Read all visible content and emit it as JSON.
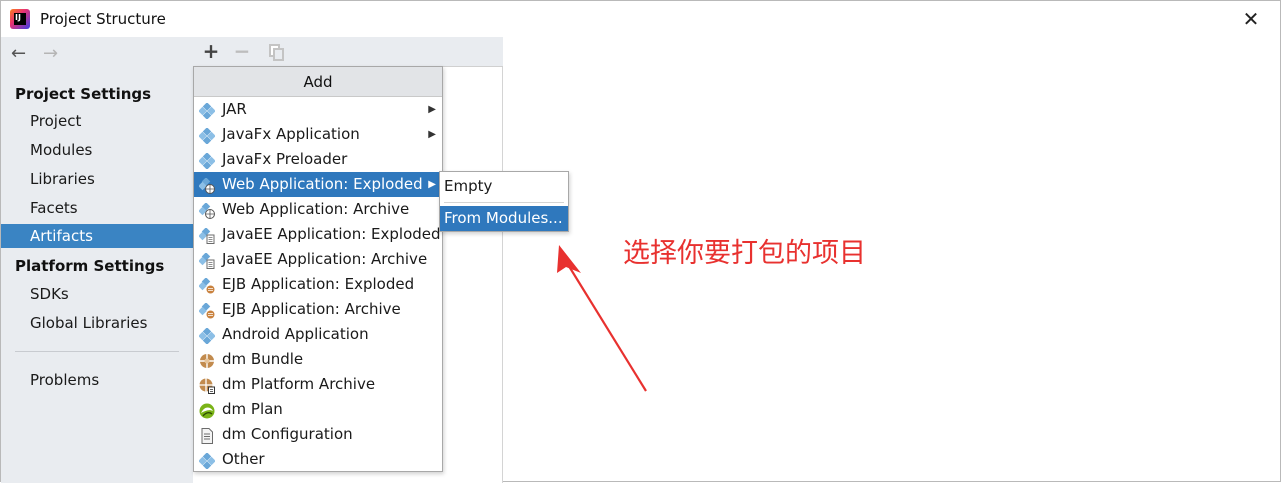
{
  "window": {
    "title": "Project Structure",
    "close_glyph": "✕",
    "app_icon_text": "IJ"
  },
  "sidebar": {
    "back_glyph": "←",
    "forward_glyph": "→",
    "project_settings_title": "Project Settings",
    "project_settings_items": [
      {
        "label": "Project",
        "selected": false
      },
      {
        "label": "Modules",
        "selected": false
      },
      {
        "label": "Libraries",
        "selected": false
      },
      {
        "label": "Facets",
        "selected": false
      },
      {
        "label": "Artifacts",
        "selected": true
      }
    ],
    "platform_settings_title": "Platform Settings",
    "platform_settings_items": [
      {
        "label": "SDKs"
      },
      {
        "label": "Global Libraries"
      }
    ],
    "problems_label": "Problems"
  },
  "toolbar": {
    "add_glyph": "+",
    "remove_glyph": "−"
  },
  "add_menu": {
    "header": "Add",
    "items": [
      {
        "label": "JAR",
        "icon": "artifact-icon",
        "has_submenu": true
      },
      {
        "label": "JavaFx Application",
        "icon": "artifact-icon",
        "has_submenu": true
      },
      {
        "label": "JavaFx Preloader",
        "icon": "artifact-icon",
        "has_submenu": false
      },
      {
        "label": "Web Application: Exploded",
        "icon": "web-artifact-icon",
        "has_submenu": true,
        "active": true
      },
      {
        "label": "Web Application: Archive",
        "icon": "web-artifact-icon",
        "has_submenu": false
      },
      {
        "label": "JavaEE Application: Exploded",
        "icon": "javaee-artifact-icon",
        "has_submenu": false
      },
      {
        "label": "JavaEE Application: Archive",
        "icon": "javaee-artifact-icon",
        "has_submenu": false
      },
      {
        "label": "EJB Application: Exploded",
        "icon": "ejb-artifact-icon",
        "has_submenu": false
      },
      {
        "label": "EJB Application: Archive",
        "icon": "ejb-artifact-icon",
        "has_submenu": false
      },
      {
        "label": "Android Application",
        "icon": "artifact-icon",
        "has_submenu": false
      },
      {
        "label": "dm Bundle",
        "icon": "bundle-icon",
        "has_submenu": false
      },
      {
        "label": "dm Platform Archive",
        "icon": "platform-archive-icon",
        "has_submenu": false
      },
      {
        "label": "dm Plan",
        "icon": "plan-icon",
        "has_submenu": false
      },
      {
        "label": "dm Configuration",
        "icon": "configuration-icon",
        "has_submenu": false
      },
      {
        "label": "Other",
        "icon": "artifact-icon",
        "has_submenu": false
      }
    ]
  },
  "submenu": {
    "items": [
      {
        "label": "Empty",
        "active": false
      },
      {
        "label": "From Modules...",
        "active": true
      }
    ]
  },
  "annotation": {
    "text": "选择你要打包的项目",
    "color": "#e8312f"
  },
  "colors": {
    "selection": "#3a84c3",
    "menu_highlight": "#2f78bd",
    "sidebar_bg": "#e9ecf0"
  }
}
